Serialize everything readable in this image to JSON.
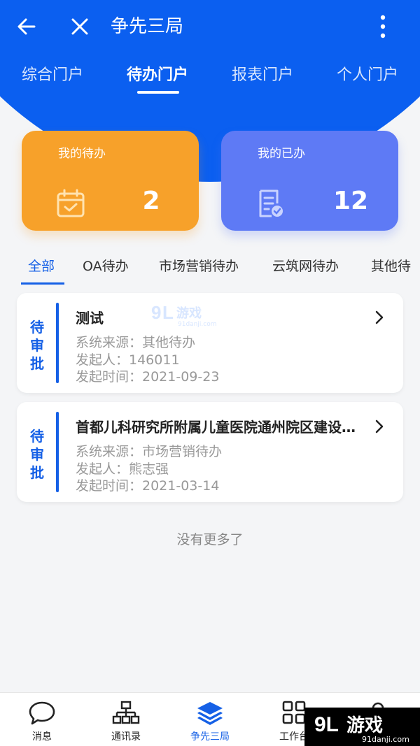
{
  "header": {
    "title": "争先三局",
    "portal_tabs": [
      {
        "label": "综合门户"
      },
      {
        "label": "待办门户"
      },
      {
        "label": "报表门户"
      },
      {
        "label": "个人门户"
      }
    ],
    "active_portal_tab": "待办门户"
  },
  "stats": {
    "todo": {
      "label": "我的待办",
      "count": "2"
    },
    "done": {
      "label": "我的已办",
      "count": "12"
    }
  },
  "filter_tabs": [
    {
      "label": "全部"
    },
    {
      "label": "OA待办"
    },
    {
      "label": "市场营销待办"
    },
    {
      "label": "云筑网待办"
    },
    {
      "label": "其他待"
    }
  ],
  "active_filter_tab": "全部",
  "items": [
    {
      "status": "待审批",
      "title": "测试",
      "source": "系统来源：其他待办",
      "initiator": "发起人：146011",
      "time": "发起时间：2021-09-23"
    },
    {
      "status": "待审批",
      "title": "首都儿科研究所附属儿童医院通州院区建设…",
      "source": "系统来源：市场营销待办",
      "initiator": "发起人：熊志强",
      "time": "发起时间：2021-03-14"
    }
  ],
  "no_more_text": "没有更多了",
  "bottom_nav": [
    {
      "label": "消息",
      "icon": "chat-bubble-icon"
    },
    {
      "label": "通讯录",
      "icon": "org-chart-icon"
    },
    {
      "label": "争先三局",
      "icon": "layers-icon"
    },
    {
      "label": "工作台",
      "icon": "grid-icon"
    },
    {
      "label": "",
      "icon": "user-icon"
    }
  ],
  "watermark": {
    "brand": "游戏",
    "site": "91danji.com"
  },
  "colors": {
    "header_blue": "#0b5ff0",
    "accent_blue": "#1560e6",
    "todo_orange": "#f7a12a",
    "done_purple": "#5e7af5"
  }
}
